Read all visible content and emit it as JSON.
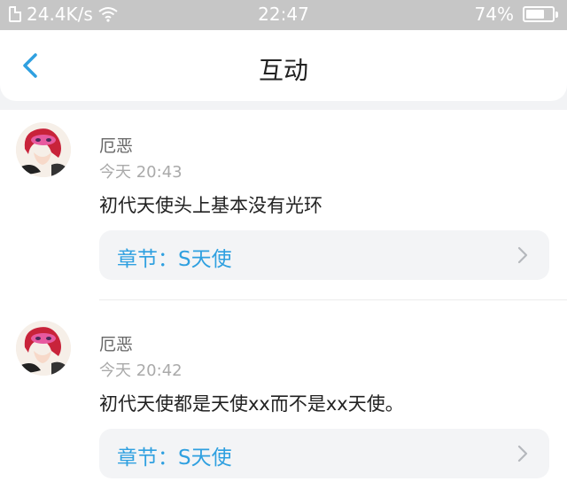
{
  "status_bar": {
    "speed": "24.4K/s",
    "time": "22:47",
    "battery": "74%",
    "battery_level": 0.74
  },
  "nav": {
    "title": "互动"
  },
  "comments": [
    {
      "author": "厄恶",
      "time": "今天 20:43",
      "text": "初代天使头上基本没有光环",
      "chapter_label": "章节：S天使"
    },
    {
      "author": "厄恶",
      "time": "今天 20:42",
      "text": "初代天使都是天使xx而不是xx天使。",
      "chapter_label": "章节：S天使"
    }
  ],
  "colors": {
    "accent": "#2fa0e0",
    "status_bar_bg": "#c6c6c6"
  },
  "icons": [
    "sim-icon",
    "wifi-icon",
    "battery-icon",
    "back-chevron-icon",
    "chevron-right-icon"
  ]
}
